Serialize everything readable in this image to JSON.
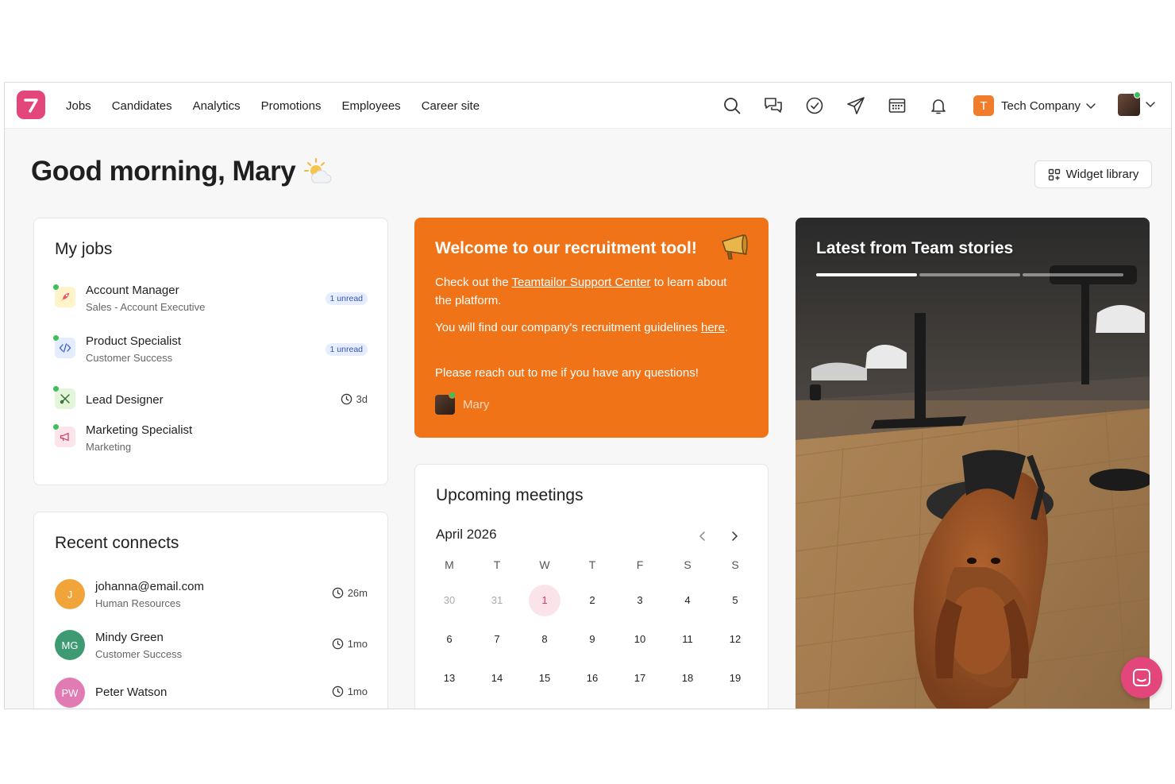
{
  "nav": {
    "links": [
      "Jobs",
      "Candidates",
      "Analytics",
      "Promotions",
      "Employees",
      "Career site"
    ],
    "icons": [
      "search-icon",
      "chat-icon",
      "check-circle-icon",
      "send-icon",
      "calendar-icon",
      "bell-icon"
    ],
    "company_initial": "T",
    "company_name": "Tech Company"
  },
  "greeting": {
    "text": "Good morning, Mary"
  },
  "widget_library": {
    "label": "Widget library"
  },
  "my_jobs": {
    "title": "My jobs",
    "items": [
      {
        "title": "Account Manager",
        "subtitle": "Sales - Account Executive",
        "badge": "1 unread",
        "icon": "rocket-icon"
      },
      {
        "title": "Product Specialist",
        "subtitle": "Customer Success",
        "badge": "1 unread",
        "icon": "code-icon"
      },
      {
        "title": "Lead Designer",
        "subtitle": "",
        "time": "3d",
        "icon": "design-tools-icon"
      },
      {
        "title": "Marketing Specialist",
        "subtitle": "Marketing",
        "icon": "megaphone-icon"
      }
    ]
  },
  "recent_connects": {
    "title": "Recent connects",
    "items": [
      {
        "initials": "J",
        "name": "johanna@email.com",
        "subtitle": "Human Resources",
        "time": "26m",
        "color": "#f0a43a"
      },
      {
        "initials": "MG",
        "name": "Mindy Green",
        "subtitle": "Customer Success",
        "time": "1mo",
        "color": "#3d9a73"
      },
      {
        "initials": "PW",
        "name": "Peter Watson",
        "subtitle": "",
        "time": "1mo",
        "color": "#e07bb3"
      }
    ]
  },
  "welcome": {
    "title": "Welcome to our recruitment tool!",
    "p1_before": "Check out the ",
    "p1_link": "Teamtailor Support Center",
    "p1_after": " to learn about the platform.",
    "p2_before": "You will find our company's recruitment guidelines ",
    "p2_link": "here",
    "p2_after": ".",
    "p3": "Please reach out to me if you have any questions!",
    "signature": "Mary"
  },
  "meetings": {
    "title": "Upcoming meetings",
    "month": "April 2026",
    "weekdays": [
      "M",
      "T",
      "W",
      "T",
      "F",
      "S",
      "S"
    ],
    "weeks": [
      [
        "30",
        "31",
        "1",
        "2",
        "3",
        "4",
        "5"
      ],
      [
        "6",
        "7",
        "8",
        "9",
        "10",
        "11",
        "12"
      ],
      [
        "13",
        "14",
        "15",
        "16",
        "17",
        "18",
        "19"
      ]
    ],
    "today": "1"
  },
  "stories": {
    "title": "Latest from Team stories",
    "story_count": 3,
    "active_story": 1
  },
  "colors": {
    "brand": "#e3467a",
    "accent_orange": "#f07318",
    "online": "#3fbf5a"
  }
}
